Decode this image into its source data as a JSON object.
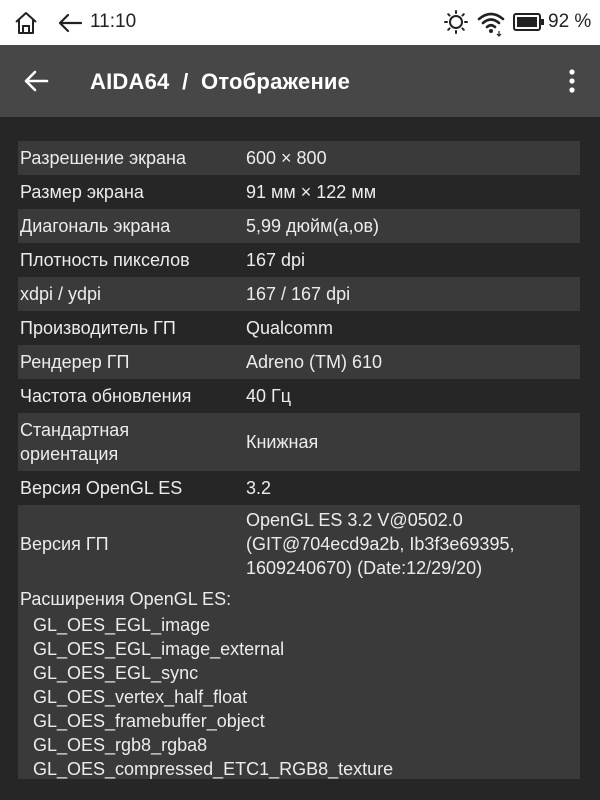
{
  "status_bar": {
    "time": "11:10",
    "battery": "92 %",
    "icons": [
      "home-icon",
      "back-arrow-icon",
      "brightness-icon",
      "wifi-icon",
      "battery-icon"
    ]
  },
  "app_bar": {
    "title": "AIDA64  /  Отображение",
    "icons": [
      "back-arrow-icon",
      "more-vertical-icon"
    ]
  },
  "rows": [
    {
      "label": "Разрешение экрана",
      "value": "600 × 800"
    },
    {
      "label": "Размер экрана",
      "value": "91 мм × 122 мм"
    },
    {
      "label": "Диагональ экрана",
      "value": "5,99 дюйм(а,ов)"
    },
    {
      "label": "Плотность пикселов",
      "value": "167 dpi"
    },
    {
      "label": "xdpi / ydpi",
      "value": "167 / 167 dpi"
    },
    {
      "label": "Производитель ГП",
      "value": "Qualcomm"
    },
    {
      "label": "Рендерер ГП",
      "value": "Adreno (TM) 610"
    },
    {
      "label": "Частота обновления",
      "value": "40 Гц"
    },
    {
      "label": "Стандартная ориентация",
      "value": "Книжная"
    },
    {
      "label": "Версия OpenGL ES",
      "value": "3.2"
    },
    {
      "label": "Версия ГП",
      "value": "OpenGL ES 3.2 V@0502.0 (GIT@704ecd9a2b, Ib3f3e69395, 1609240670) (Date:12/29/20)"
    }
  ],
  "extensions": {
    "header": "Расширения OpenGL ES:",
    "items": [
      "GL_OES_EGL_image",
      "GL_OES_EGL_image_external",
      "GL_OES_EGL_sync",
      "GL_OES_vertex_half_float",
      "GL_OES_framebuffer_object",
      "GL_OES_rgb8_rgba8",
      "GL_OES_compressed_ETC1_RGB8_texture"
    ]
  },
  "colors": {
    "app_bar": "#474747",
    "background": "#262626",
    "row_shaded": "#3a3a3a",
    "text": "#ececec"
  }
}
